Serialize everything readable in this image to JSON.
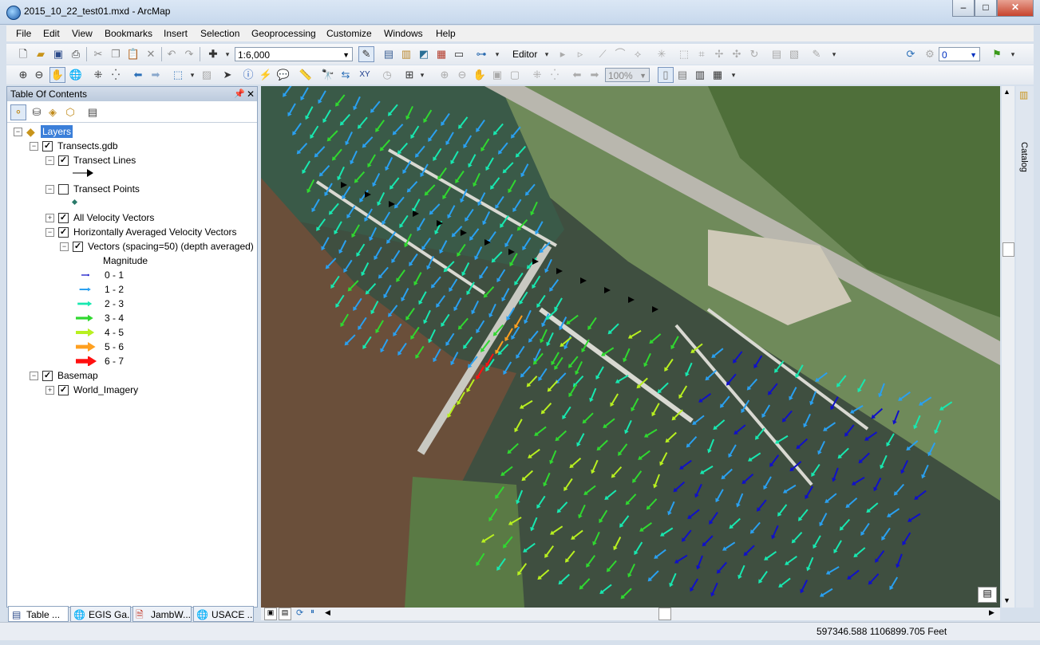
{
  "window": {
    "title": "2015_10_22_test01.mxd - ArcMap"
  },
  "menu": [
    "File",
    "Edit",
    "View",
    "Bookmarks",
    "Insert",
    "Selection",
    "Geoprocessing",
    "Customize",
    "Windows",
    "Help"
  ],
  "toolbar": {
    "scale_value": "1:6,000",
    "editor_label": "Editor",
    "zoom_value": "100%",
    "layer_combo_value": "0"
  },
  "toc": {
    "title": "Table Of Contents",
    "root_label": "Layers",
    "group1": "Transects.gdb",
    "layer_transect_lines": "Transect Lines",
    "layer_transect_points": "Transect Points",
    "layer_all_vectors": "All Velocity Vectors",
    "layer_horiz_vectors": "Horizontally Averaged Velocity Vectors",
    "sublayer_vectors": "Vectors (spacing=50) (depth averaged)",
    "legend_heading": "Magnitude",
    "legend": [
      {
        "label": "0 - 1",
        "color": "#1010c8"
      },
      {
        "label": "1 - 2",
        "color": "#2aa0f0"
      },
      {
        "label": "2 - 3",
        "color": "#18e8b0"
      },
      {
        "label": "3 - 4",
        "color": "#30d830"
      },
      {
        "label": "4 - 5",
        "color": "#b8f020"
      },
      {
        "label": "5 - 6",
        "color": "#ffa020"
      },
      {
        "label": "6 - 7",
        "color": "#ff1010"
      }
    ],
    "group2": "Basemap",
    "layer_imagery": "World_Imagery"
  },
  "bottom_tabs": [
    "Table ...",
    "EGIS Ga...",
    "JambW...",
    "USACE ..."
  ],
  "catalog_label": "Catalog",
  "status": {
    "coordinates": "597346.588  1106899.705 Feet"
  }
}
